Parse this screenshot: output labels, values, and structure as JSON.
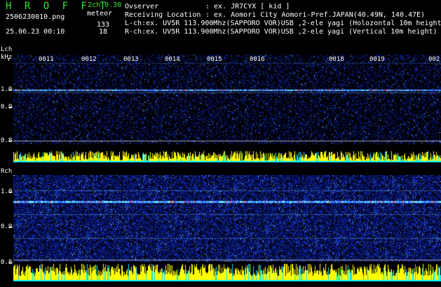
{
  "header": {
    "app_title": "H R O F F T",
    "version": "2ch 0.30",
    "mode": "meteor",
    "filename": "2506230010.png",
    "datetime": "25.06.23 00:10",
    "count_l": "133",
    "count_r": "18",
    "observer_label": "Ovserver",
    "observer_value": ": ex. JR7CYX [ kid ]",
    "location_label": "Receiving Location",
    "location_value": ": ex. Aomori City Aomori-Pref.JAPAN(40.49N, 140.47E)",
    "lch_info": "L-ch:ex. UV5R 113.900Mhz(SAPPORO VOR)USB ,2-ele yagi (Holozontal 10m height)",
    "rch_info": "R-ch:ex. UV5R 113.900Mhz(SAPPORO VOR)USB ,2-ele yagi (Vertical 10m height)"
  },
  "lch": {
    "channel_label": "Lch",
    "unit_label": "kHz",
    "y_ticks": [
      "1.0",
      "0.9",
      "0.8"
    ],
    "minute_labels": [
      "0011",
      "0012",
      "0013",
      "0014",
      "0015",
      "0016",
      "0018",
      "0019",
      "002"
    ]
  },
  "rch": {
    "channel_label": "Rch",
    "y_ticks": [
      "1.0",
      "0.9",
      "0.8"
    ]
  },
  "colors": {
    "title_green": "#2ee82e",
    "text": "#ffffff",
    "background_noise": "#0a1470",
    "signal_line": "#66e0ff",
    "peak_red": "#ff3030",
    "level_yellow": "#ffff00",
    "level_cyan": "#00e5ff"
  }
}
